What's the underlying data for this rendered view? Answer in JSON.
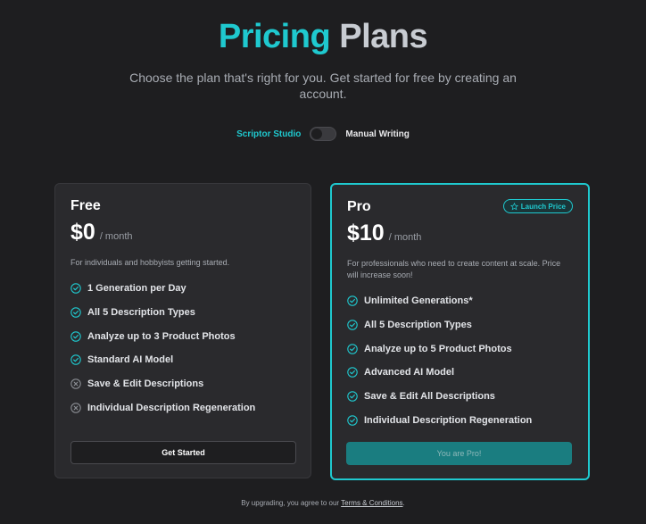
{
  "header": {
    "title_word1": "Pricing",
    "title_word2": "Plans",
    "subtitle": "Choose the plan that's right for you. Get started for free by creating an account."
  },
  "toggle": {
    "left_label": "Scriptor Studio",
    "right_label": "Manual Writing"
  },
  "plans": {
    "free": {
      "name": "Free",
      "price": "$0",
      "period": "/ month",
      "description": "For individuals and hobbyists getting started.",
      "features": [
        {
          "label": "1 Generation per Day",
          "included": true
        },
        {
          "label": "All 5 Description Types",
          "included": true
        },
        {
          "label": "Analyze up to 3 Product Photos",
          "included": true
        },
        {
          "label": "Standard AI Model",
          "included": true
        },
        {
          "label": "Save & Edit Descriptions",
          "included": false
        },
        {
          "label": "Individual Description Regeneration",
          "included": false
        }
      ],
      "button_label": "Get Started"
    },
    "pro": {
      "name": "Pro",
      "badge": "Launch Price",
      "price": "$10",
      "period": "/ month",
      "description": "For professionals who need to create content at scale. Price will increase soon!",
      "features": [
        {
          "label": "Unlimited Generations*",
          "included": true
        },
        {
          "label": "All 5 Description Types",
          "included": true
        },
        {
          "label": "Analyze up to 5 Product Photos",
          "included": true
        },
        {
          "label": "Advanced AI Model",
          "included": true
        },
        {
          "label": "Save & Edit All Descriptions",
          "included": true
        },
        {
          "label": "Individual Description Regeneration",
          "included": true
        }
      ],
      "button_label": "You are Pro!"
    }
  },
  "footer": {
    "prefix": "By upgrading, you agree to our",
    "link_label": "Terms & Conditions",
    "suffix": "."
  },
  "colors": {
    "accent": "#1fc9cf",
    "background": "#1e1e20",
    "card": "#2a2a2d"
  }
}
